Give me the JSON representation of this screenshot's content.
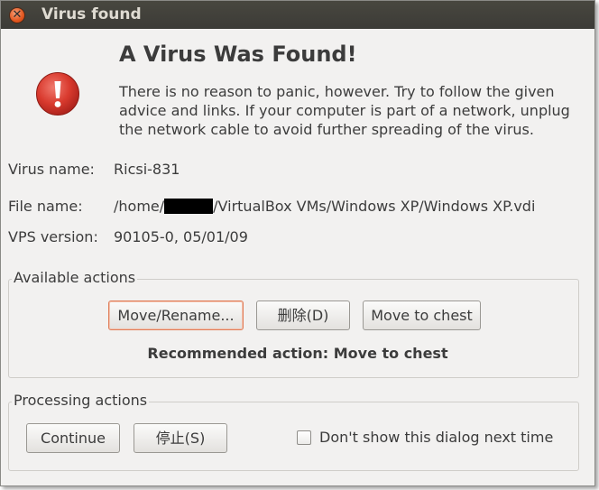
{
  "window": {
    "title": "Virus found",
    "close_symbol": "✕"
  },
  "icons": {
    "title_close": "close-icon",
    "alert": "error-exclamation-icon"
  },
  "colors": {
    "alert_red": "#d32f2f",
    "close_orange": "#e2561f",
    "default_button_border": "#e07e5a"
  },
  "dialog": {
    "heading": "A Virus Was Found!",
    "message": "There is no reason to panic, however. Try to follow the given advice and links. If your computer is part of a network, unplug the network cable to avoid further spreading of the virus."
  },
  "info": {
    "virus_name_label": "Virus name:",
    "virus_name_value": "Ricsi-831",
    "file_name_label": "File name:",
    "file_name_prefix": "/home/",
    "file_name_suffix": "/VirtualBox VMs/Windows XP/Windows XP.vdi",
    "vps_version_label": "VPS version:",
    "vps_version_value": "90105-0, 05/01/09"
  },
  "available_actions": {
    "title": "Available actions",
    "move_rename_label": "Move/Rename...",
    "delete_label": "删除(D)",
    "move_to_chest_label": "Move to chest",
    "recommended": "Recommended action: Move to chest"
  },
  "processing_actions": {
    "title": "Processing actions",
    "continue_label": "Continue",
    "stop_label": "停止(S)",
    "dont_show_label": "Don't show this dialog next time",
    "dont_show_checked": false
  }
}
